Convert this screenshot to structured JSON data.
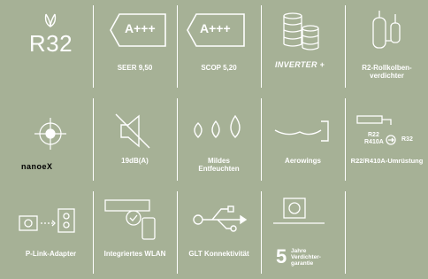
{
  "features": [
    {
      "id": "r32",
      "big_text": "R32",
      "label": ""
    },
    {
      "id": "seer",
      "badge": "A+++",
      "label": "SEER 9,50"
    },
    {
      "id": "scop",
      "badge": "A+++",
      "label": "SCOP 5,20"
    },
    {
      "id": "inverter",
      "logo": "INVERTER +",
      "label": ""
    },
    {
      "id": "rollkolben",
      "label": "R2-Rollkolben-\nverdichter"
    },
    {
      "id": "nanoe",
      "logo": "nanoeX",
      "label": ""
    },
    {
      "id": "db",
      "label": "19dB(A)"
    },
    {
      "id": "entfeuchten",
      "label": "Mildes\nEntfeuchten"
    },
    {
      "id": "aerowings",
      "label": "Aerowings"
    },
    {
      "id": "umruestung",
      "top_left": "R22",
      "bottom_left": "R410A",
      "right": "R32",
      "label": "R22/R410A-Umrüstung"
    },
    {
      "id": "plink",
      "label": "P-Link-Adapter"
    },
    {
      "id": "wlan",
      "label": "Integriertes WLAN"
    },
    {
      "id": "glt",
      "label": "GLT Konnektivität"
    },
    {
      "id": "garantie",
      "number": "5",
      "text": "Jahre\nVerdichter-\ngarantie",
      "label": ""
    }
  ],
  "colors": {
    "background": "#a6b196",
    "foreground": "#ffffff"
  }
}
